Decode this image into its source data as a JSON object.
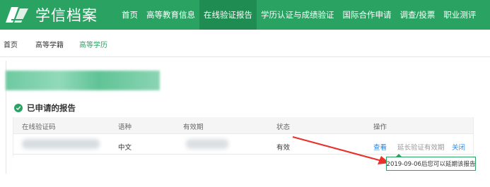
{
  "header": {
    "logo_text": "学信档案",
    "nav": [
      {
        "label": "首页",
        "active": false
      },
      {
        "label": "高等教育信息",
        "active": false
      },
      {
        "label": "在线验证报告",
        "active": true
      },
      {
        "label": "学历认证与成绩验证",
        "active": false
      },
      {
        "label": "国际合作申请",
        "active": false
      },
      {
        "label": "调查/投票",
        "active": false
      },
      {
        "label": "职业测评",
        "active": false
      }
    ],
    "accent_color": "#2aa362"
  },
  "subnav": {
    "items": [
      {
        "label": "首页",
        "active": false
      },
      {
        "label": "高等学籍",
        "active": false
      },
      {
        "label": "高等学历",
        "active": true
      }
    ]
  },
  "section": {
    "title": "已申请的报告",
    "icon": "check-circle-icon"
  },
  "table": {
    "headers": [
      "在线验证码",
      "语种",
      "有效期",
      "状态",
      "操作"
    ],
    "row": {
      "language": "中文",
      "status": "有效",
      "actions": {
        "view": "查看",
        "extend": "延长验证有效期",
        "close": "关闭"
      }
    }
  },
  "tooltip": {
    "text": "2019-09-06后您可以延期该报告"
  }
}
